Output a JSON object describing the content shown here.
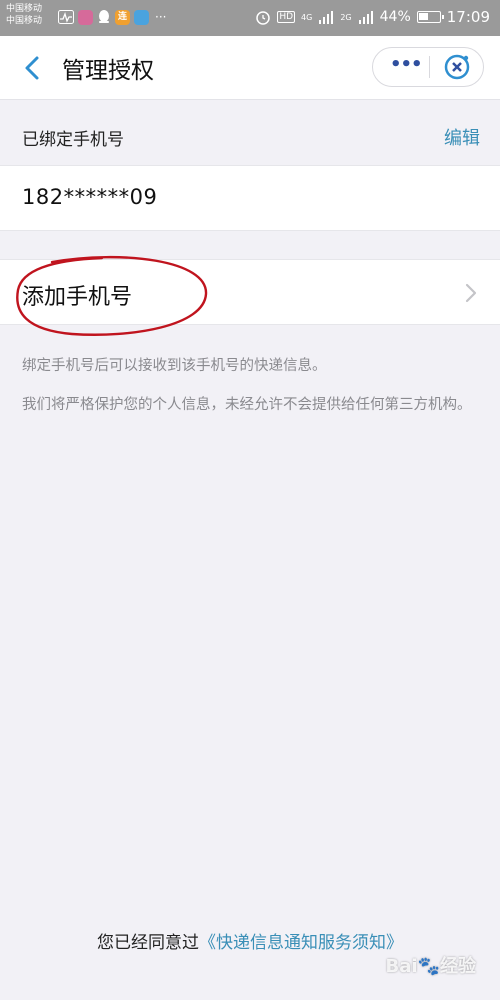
{
  "status_bar": {
    "carrier_1": "中国移动",
    "carrier_2": "中国移动",
    "app_badge_text": "连",
    "more_dots": "···",
    "hd": "HD",
    "net_1": "4G",
    "net_2": "2G",
    "battery": "44%",
    "time": "17:09"
  },
  "nav": {
    "title": "管理授权",
    "more_dots": "•••"
  },
  "bound": {
    "title": "已绑定手机号",
    "edit": "编辑",
    "phone": "182******09"
  },
  "add_row": {
    "label": "添加手机号"
  },
  "notes": {
    "line1": "绑定手机号后可以接收到该手机号的快递信息。",
    "line2": "我们将严格保护您的个人信息，未经允许不会提供给任何第三方机构。"
  },
  "footer": {
    "prefix": "您已经同意过",
    "link": "《快递信息通知服务须知》"
  },
  "watermark": "Bai🐾经验",
  "colors": {
    "accent": "#3a8fb7",
    "background": "#f2f1f6",
    "annotation": "#c0141e"
  }
}
